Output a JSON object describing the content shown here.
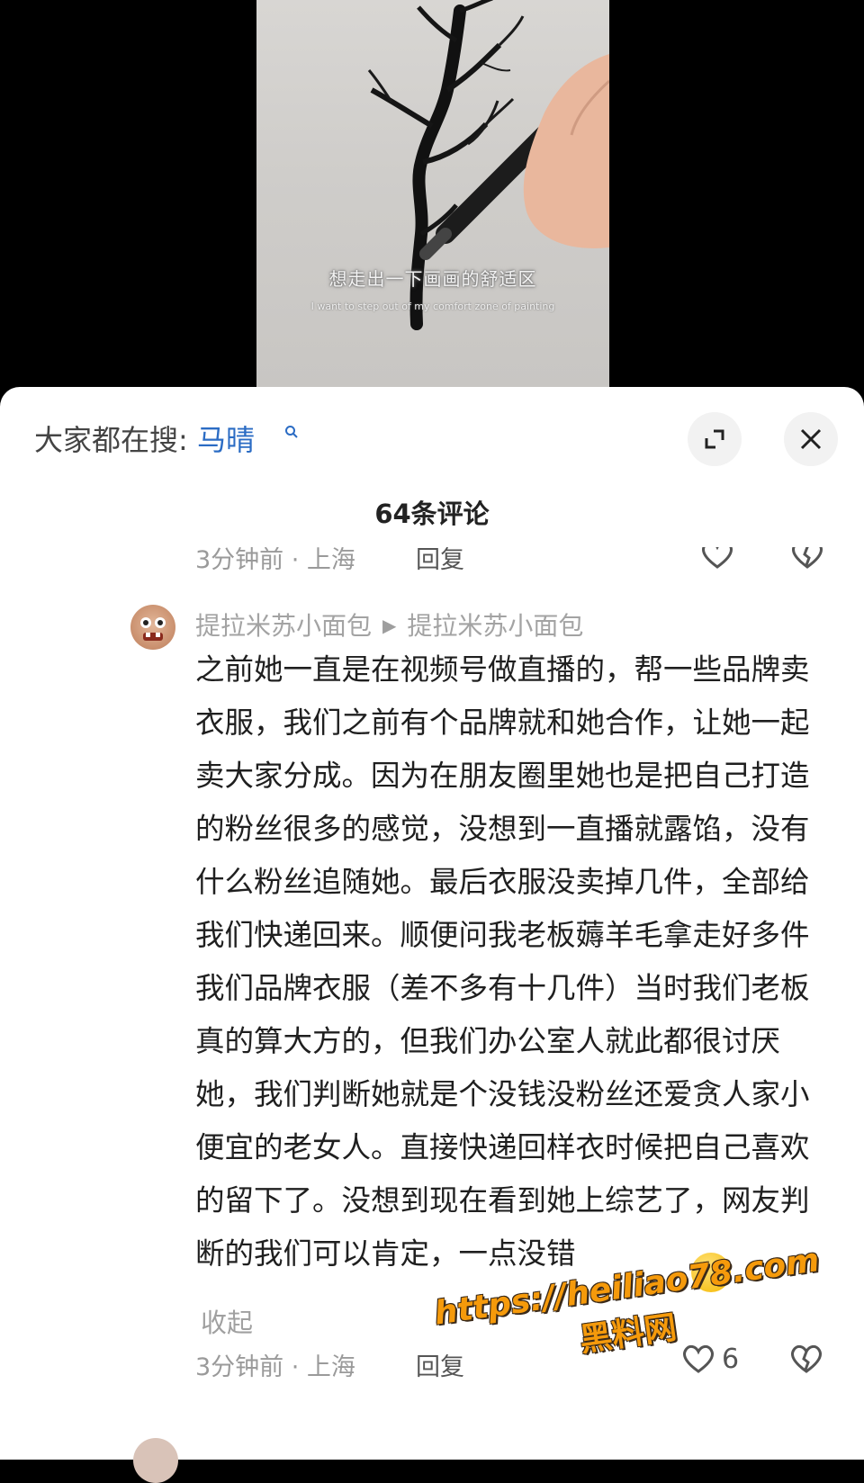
{
  "video": {
    "subtitle_cn": "想走出一下画画的舒适区",
    "subtitle_en": "I want to step out of my comfort zone of painting"
  },
  "search": {
    "prefix": "大家都在搜:",
    "term": "马晴"
  },
  "comments": {
    "count_label": "64条评论",
    "previous": {
      "time_location": "3分钟前 · 上海",
      "reply_label": "回复"
    },
    "main": {
      "author": "提拉米苏小面包",
      "reply_to": "提拉米苏小面包",
      "text": "之前她一直是在视频号做直播的，帮一些品牌卖衣服，我们之前有个品牌就和她合作，让她一起卖大家分成。因为在朋友圈里她也是把自己打造的粉丝很多的感觉，没想到一直播就露馅，没有什么粉丝追随她。最后衣服没卖掉几件，全部给我们快递回来。顺便问我老板薅羊毛拿走好多件我们品牌衣服（差不多有十几件）当时我们老板真的算大方的，但我们办公室人就此都很讨厌她，我们判断她就是个没钱没粉丝还爱贪人家小便宜的老女人。直接快递回样衣时候把自己喜欢的留下了。没想到现在看到她上综艺了，网友判断的我们可以肯定，一点没错",
      "collapse_label": "收起",
      "time_location": "3分钟前 · 上海",
      "reply_label": "回复",
      "like_count": "6"
    }
  },
  "watermark": {
    "url": "https://heiliao78.com",
    "name": "黑料网"
  },
  "colors": {
    "search_term": "#2b6cc4",
    "watermark": "#f59a0b"
  }
}
